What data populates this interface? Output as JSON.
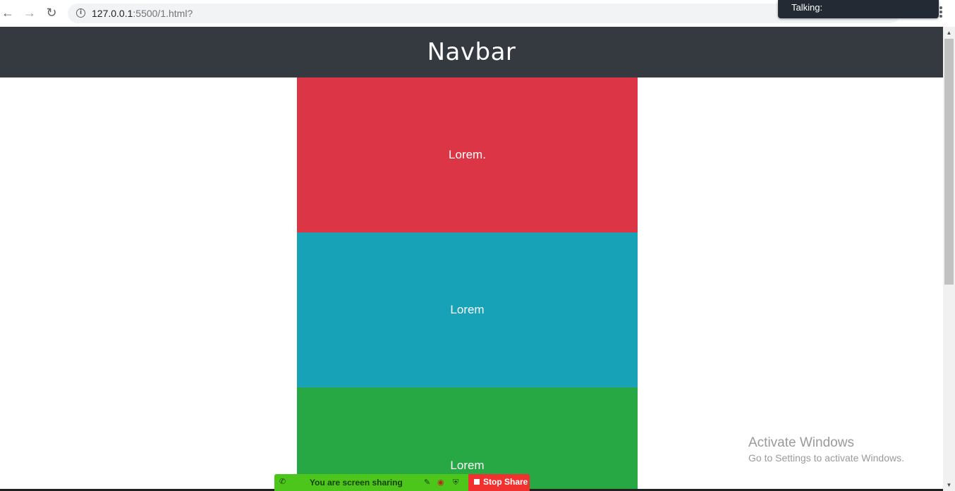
{
  "browser": {
    "url_host": "127.0.0.1",
    "url_rest": ":5500/1.html?",
    "back_icon": "←",
    "forward_icon": "→",
    "reload_icon": "↻",
    "info_icon": "i"
  },
  "talking_popup": {
    "label": "Talking:"
  },
  "navbar": {
    "title": "Navbar"
  },
  "blocks": [
    {
      "label": "Lorem.",
      "color": "#dc3545"
    },
    {
      "label": "Lorem",
      "color": "#17a2b8"
    },
    {
      "label": "Lorem",
      "color": "#28a745"
    }
  ],
  "watermark": {
    "title": "Activate Windows",
    "subtitle": "Go to Settings to activate Windows."
  },
  "share_bar": {
    "status": "You are screen sharing",
    "stop_label": "Stop Share",
    "phone_icon": "✆",
    "mic_icon": "✎",
    "record_icon": "◉",
    "shield_icon": "⛨"
  }
}
